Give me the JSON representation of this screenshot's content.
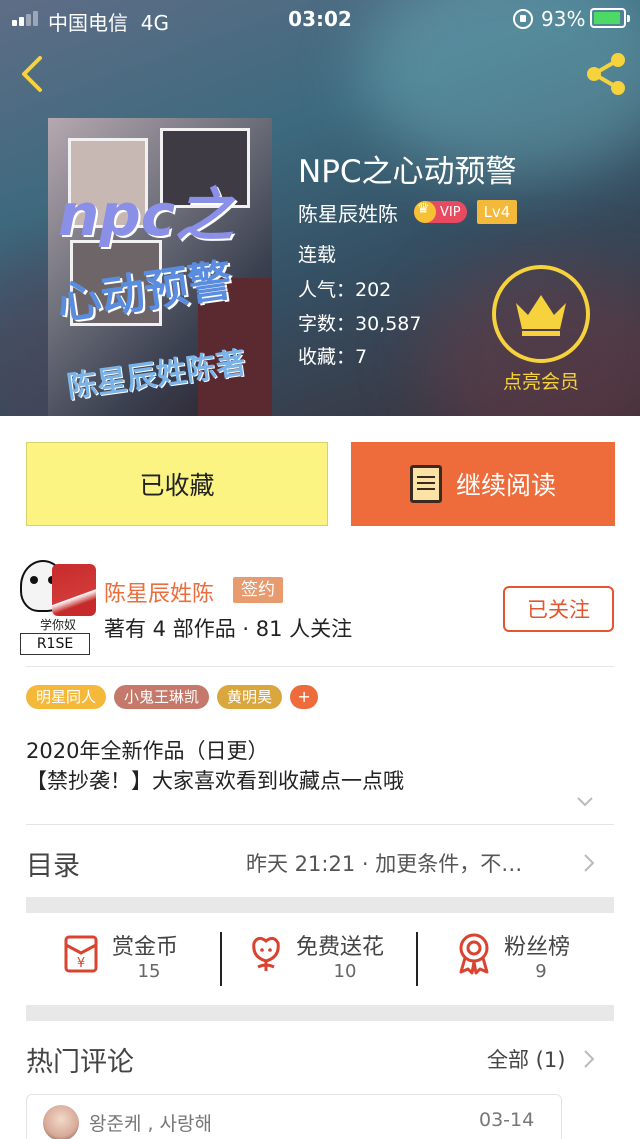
{
  "status_bar": {
    "carrier": "中国电信",
    "network": "4G",
    "time": "03:02",
    "battery": "93%"
  },
  "book": {
    "title": "NPC之心动预警",
    "author": "陈星辰姓陈",
    "vip": "VIP",
    "level": "Lv4",
    "status": "连载",
    "popularity": "人气：202",
    "word_count": "字数：30,587",
    "favorites": "收藏：7",
    "member_label": "点亮会员",
    "cover_text": [
      "npc之",
      "心动预警",
      "陈星辰姓陈著"
    ]
  },
  "actions": {
    "collected": "已收藏",
    "continue_reading": "继续阅读"
  },
  "author_card": {
    "avatar_caption": "学你奴",
    "avatar_tag": "R1SE",
    "name": "陈星辰姓陈",
    "badge": "签约",
    "works": "著有 4 部作品 · 81 人关注",
    "follow": "已关注"
  },
  "tags": [
    {
      "label": "明星同人",
      "color": "#f4b93a"
    },
    {
      "label": "小鬼王琳凯",
      "color": "#c4796a"
    },
    {
      "label": "黄明昊",
      "color": "#d9a73e"
    }
  ],
  "tag_more": "+",
  "description": [
    "2020年全新作品（日更）",
    "【禁抄袭！】大家喜欢看到收藏点一点哦"
  ],
  "toc": {
    "label": "目录",
    "info": "昨天 21:21 · 加更条件，不…"
  },
  "stats": [
    {
      "label": "赏金币",
      "value": "15",
      "icon": "red-envelope-icon"
    },
    {
      "label": "免费送花",
      "value": "10",
      "icon": "flower-icon"
    },
    {
      "label": "粉丝榜",
      "value": "9",
      "icon": "medal-icon"
    }
  ],
  "hot_comments": {
    "label": "热门评论",
    "all": "全部 (1)",
    "first": {
      "name": "왕준케 , 사랑해",
      "date": "03-14"
    }
  },
  "colors": {
    "accent": "#ee6c3b",
    "collected_bg": "#fbf482",
    "member_gold": "#f6d23c",
    "stat_icon": "#d9432f"
  }
}
